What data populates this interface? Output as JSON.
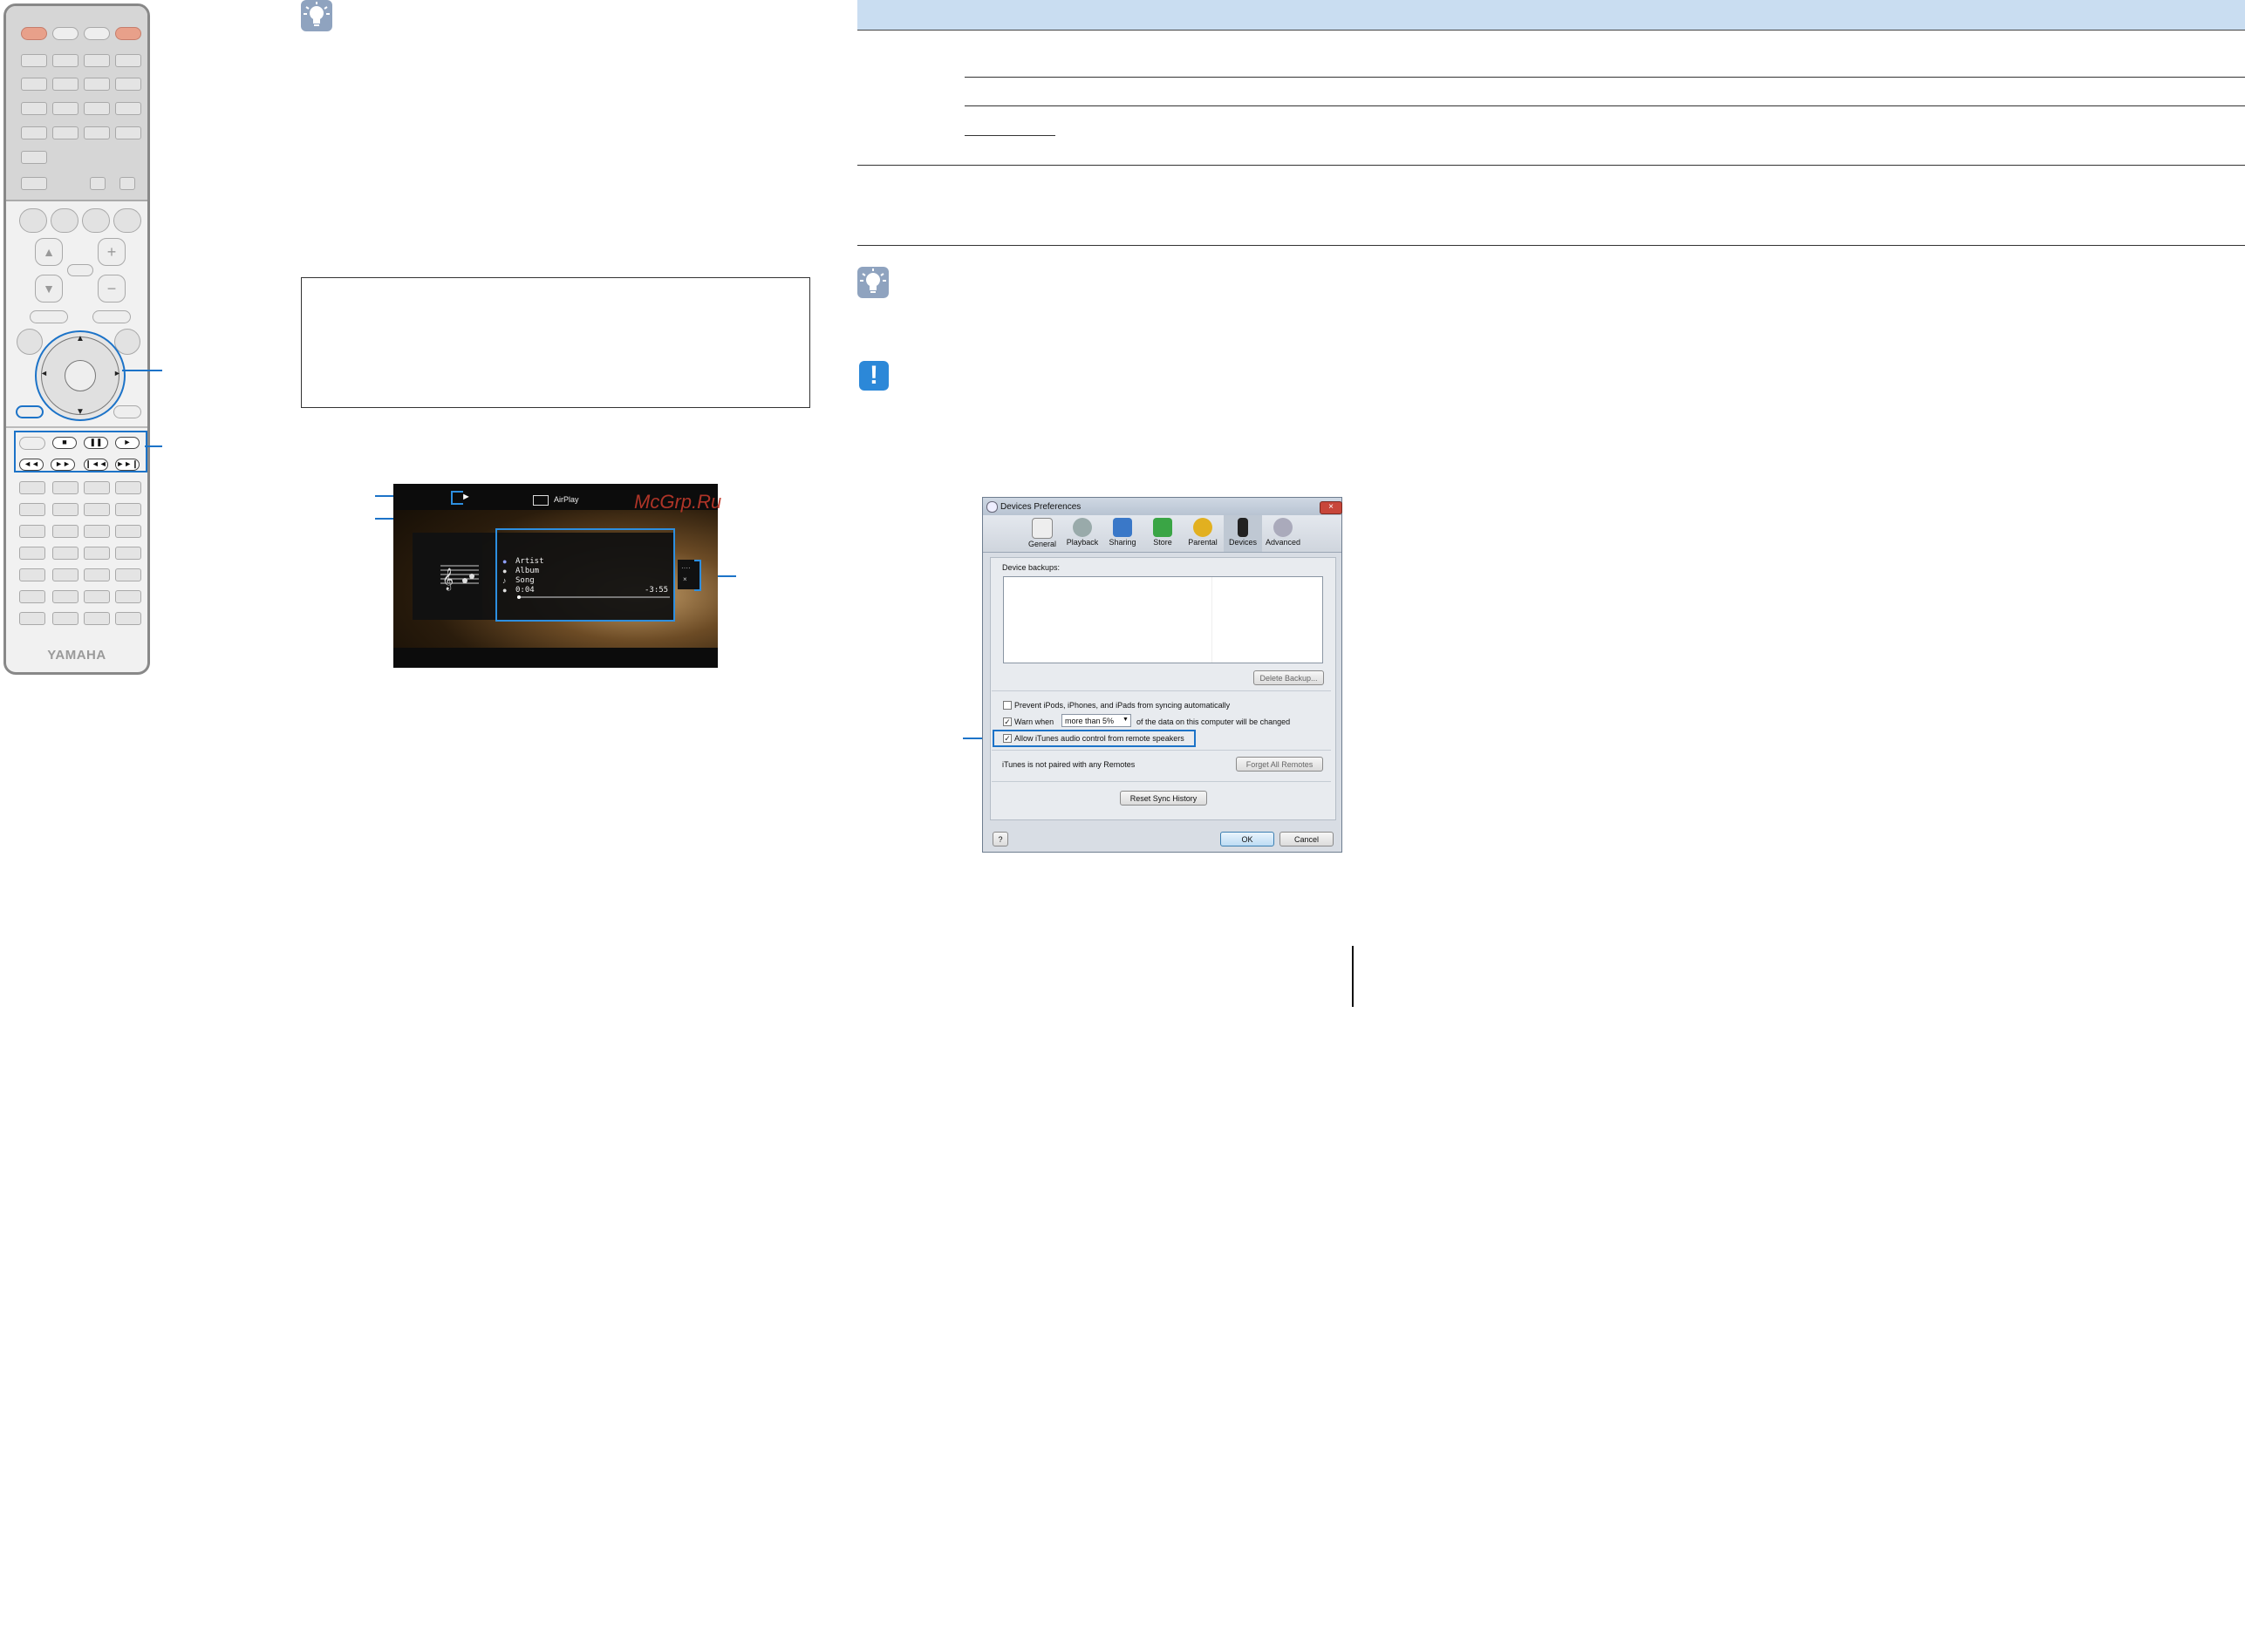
{
  "remote": {
    "brand": "YAMAHA",
    "transport_labels": [
      "■",
      "❚❚",
      "►",
      "◄◄",
      "►►",
      "❙◄◄",
      "►►❙"
    ],
    "cursor_arrows": {
      "up": "▲",
      "down": "▼",
      "left": "◄",
      "right": "►"
    },
    "volume": {
      "plus": "+",
      "minus": "−"
    }
  },
  "watermark": "McGrp.Ru",
  "screen": {
    "source": "AirPlay",
    "play_status": "►",
    "artist": "Artist",
    "album": "Album",
    "song": "Song",
    "elapsed": "0:04",
    "remaining": "-3:55",
    "side_menu": [
      "····",
      "×"
    ]
  },
  "dialog": {
    "title": "Devices Preferences",
    "close": "×",
    "tabs": [
      "General",
      "Playback",
      "Sharing",
      "Store",
      "Parental",
      "Devices",
      "Advanced"
    ],
    "active_tab": "Devices",
    "backups_label": "Device backups:",
    "delete_backup": "Delete Backup...",
    "prevent_sync": "Prevent iPods, iPhones, and iPads from syncing automatically",
    "warn_when": "Warn when",
    "warn_select": "more than 5%",
    "warn_suffix": "of the data on this computer will be changed",
    "allow_remote": "Allow iTunes audio control from remote speakers",
    "remotes_status": "iTunes is not paired with any Remotes",
    "forget_remotes": "Forget All Remotes",
    "reset_sync": "Reset Sync History",
    "help": "?",
    "ok": "OK",
    "cancel": "Cancel"
  },
  "colors": {
    "accent": "#1c73c8",
    "header_band": "#c9ddf1",
    "hint_icon": "#8fa3bf",
    "warning_icon": "#2c88d8"
  },
  "icons": [
    "lightbulb-icon",
    "exclamation-icon",
    "airplay-icon",
    "music-note-icon"
  ]
}
